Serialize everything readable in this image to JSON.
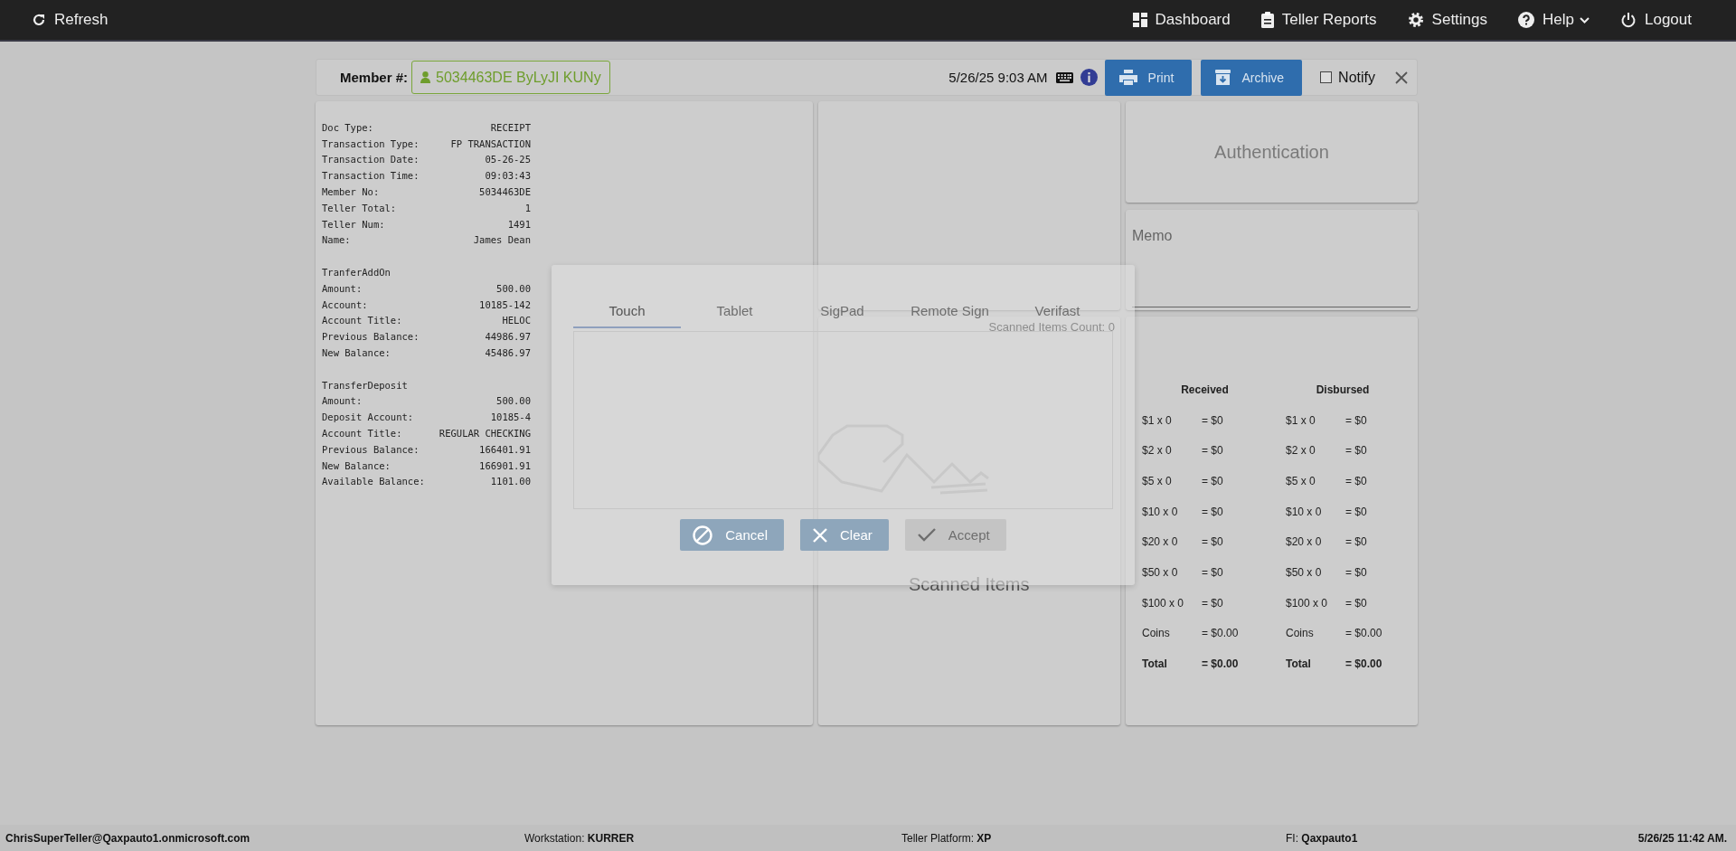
{
  "top_bar": {
    "left": [
      {
        "kind": "refresh",
        "label": "Refresh",
        "dropdown": false
      }
    ],
    "right": [
      {
        "kind": "dashboard",
        "label": "Dashboard",
        "dropdown": false
      },
      {
        "kind": "reports",
        "label": "Teller Reports",
        "dropdown": false
      },
      {
        "kind": "settings",
        "label": "Settings",
        "dropdown": false
      },
      {
        "kind": "help",
        "label": "Help",
        "dropdown": true
      },
      {
        "kind": "logout",
        "label": "Logout",
        "dropdown": false
      }
    ]
  },
  "member_bar": {
    "label": "Member #:",
    "member": "5034463DE ByLyJI KUNy",
    "datetime": "5/26/25 9:03 AM",
    "buttons": [
      {
        "kind": "print",
        "label": "Print"
      },
      {
        "kind": "archive",
        "label": "Archive"
      }
    ],
    "notify": {
      "label": "Notify",
      "checked": false
    }
  },
  "receipt": {
    "sections": [
      {
        "lines": [
          {
            "label": "Doc Type:",
            "value": "RECEIPT"
          },
          {
            "label": "Transaction Type:",
            "value": "FP TRANSACTION"
          },
          {
            "label": "Transaction Date:",
            "value": "05-26-25"
          },
          {
            "label": "Transaction Time:",
            "value": "09:03:43"
          },
          {
            "label": "Member No:",
            "value": "5034463DE"
          },
          {
            "label": "Teller Total:",
            "value": "1"
          },
          {
            "label": "Teller Num:",
            "value": "1491"
          },
          {
            "label": "Name:",
            "value": "James Dean"
          }
        ]
      },
      {
        "heading": "TranferAddOn",
        "lines": [
          {
            "label": "Amount:",
            "value": "500.00"
          },
          {
            "label": "Account:",
            "value": "10185-142"
          },
          {
            "label": "Account Title:",
            "value": "HELOC"
          },
          {
            "label": "Previous Balance:",
            "value": "44986.97"
          },
          {
            "label": "New Balance:",
            "value": "45486.97"
          }
        ]
      },
      {
        "heading": "TransferDeposit",
        "lines": [
          {
            "label": "Amount:",
            "value": "500.00"
          },
          {
            "label": "Deposit Account:",
            "value": "10185-4"
          },
          {
            "label": "Account Title:",
            "value": "REGULAR CHECKING"
          },
          {
            "label": "Previous Balance:",
            "value": "166401.91"
          },
          {
            "label": "New Balance:",
            "value": "166901.91"
          },
          {
            "label": "Available Balance:",
            "value": "1101.00"
          }
        ]
      }
    ]
  },
  "authentication": {
    "title": "Authentication"
  },
  "memo": {
    "label": "Memo"
  },
  "scanned_items": {
    "count": "Scanned Items Count: 0",
    "title": "Scanned Items"
  },
  "cash": {
    "columns": [
      {
        "title": "Received",
        "rows": [
          {
            "kind": "bill",
            "label": "$1 x 0",
            "amount": "= $0"
          },
          {
            "kind": "bill",
            "label": "$2 x 0",
            "amount": "= $0"
          },
          {
            "kind": "bill",
            "label": "$5 x 0",
            "amount": "= $0"
          },
          {
            "kind": "bill",
            "label": "$10 x 0",
            "amount": "= $0"
          },
          {
            "kind": "bill",
            "label": "$20 x 0",
            "amount": "= $0"
          },
          {
            "kind": "bill",
            "label": "$50 x 0",
            "amount": "= $0"
          },
          {
            "kind": "bill",
            "label": "$100 x 0",
            "amount": "= $0"
          },
          {
            "kind": "coins",
            "label": "Coins",
            "amount": "= $0.00"
          },
          {
            "kind": "total",
            "label": "Total",
            "amount": "= $0.00"
          }
        ]
      },
      {
        "title": "Disbursed",
        "rows": [
          {
            "kind": "bill",
            "label": "$1 x 0",
            "amount": "= $0"
          },
          {
            "kind": "bill",
            "label": "$2 x 0",
            "amount": "= $0"
          },
          {
            "kind": "bill",
            "label": "$5 x 0",
            "amount": "= $0"
          },
          {
            "kind": "bill",
            "label": "$10 x 0",
            "amount": "= $0"
          },
          {
            "kind": "bill",
            "label": "$20 x 0",
            "amount": "= $0"
          },
          {
            "kind": "bill",
            "label": "$50 x 0",
            "amount": "= $0"
          },
          {
            "kind": "bill",
            "label": "$100 x 0",
            "amount": "= $0"
          },
          {
            "kind": "coins",
            "label": "Coins",
            "amount": "= $0.00"
          },
          {
            "kind": "total",
            "label": "Total",
            "amount": "= $0.00"
          }
        ]
      }
    ]
  },
  "signature_modal": {
    "tabs": [
      {
        "label": "Touch",
        "selected": true
      },
      {
        "label": "Tablet",
        "selected": false
      },
      {
        "label": "SigPad",
        "selected": false
      },
      {
        "label": "Remote Sign",
        "selected": false
      },
      {
        "label": "Verifast",
        "selected": false
      }
    ],
    "buttons": [
      {
        "kind": "cancel",
        "label": "Cancel",
        "disabled": false
      },
      {
        "kind": "clear",
        "label": "Clear",
        "disabled": false
      },
      {
        "kind": "accept",
        "label": "Accept",
        "disabled": true
      }
    ]
  },
  "status_bar": {
    "user": "ChrisSuperTeller@Qaxpauto1.onmicrosoft.com",
    "items": [
      {
        "label": "Workstation:",
        "value": "KURRER"
      },
      {
        "label": "Teller Platform:",
        "value": "XP"
      },
      {
        "label": "FI:",
        "value": "Qaxpauto1"
      }
    ],
    "datetime": "5/26/25 11:42 AM."
  }
}
